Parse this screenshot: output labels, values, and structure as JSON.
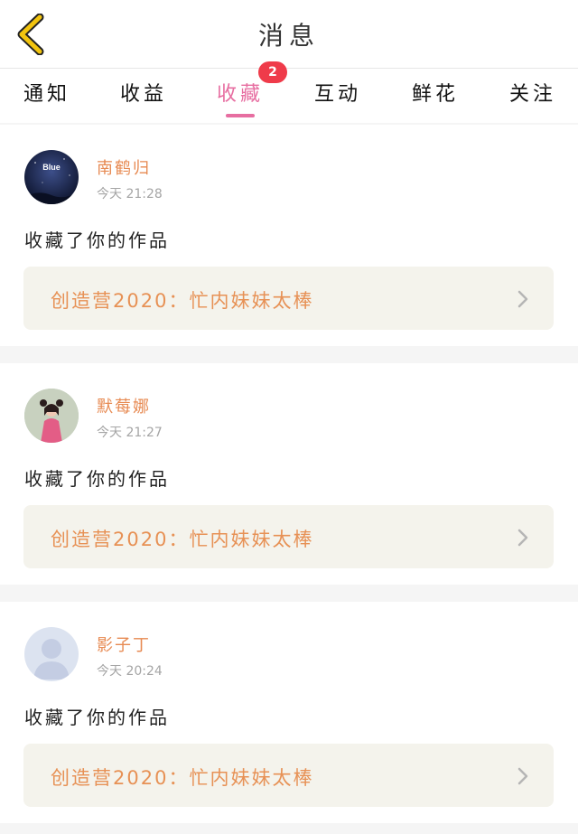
{
  "header": {
    "title": "消息"
  },
  "tabs": [
    {
      "label": "通知"
    },
    {
      "label": "收益"
    },
    {
      "label": "收藏"
    },
    {
      "label": "互动"
    },
    {
      "label": "鲜花"
    },
    {
      "label": "关注"
    }
  ],
  "active_tab": "收藏",
  "badge": {
    "count": "2"
  },
  "colors": {
    "accent_pink": "#e76ea1",
    "username_orange": "#e78a52",
    "badge_red": "#ef3b4a",
    "back_arrow_yellow": "#f2c40f"
  },
  "messages": [
    {
      "username": "南鹤归",
      "time": "今天 21:28",
      "action": "收藏了你的作品",
      "work_title": "创造营2020：忙内妹妹太棒",
      "avatar_text": "Blue"
    },
    {
      "username": "默莓娜",
      "time": "今天 21:27",
      "action": "收藏了你的作品",
      "work_title": "创造营2020：忙内妹妹太棒"
    },
    {
      "username": "影子丁",
      "time": "今天 20:24",
      "action": "收藏了你的作品",
      "work_title": "创造营2020：忙内妹妹太棒"
    }
  ]
}
